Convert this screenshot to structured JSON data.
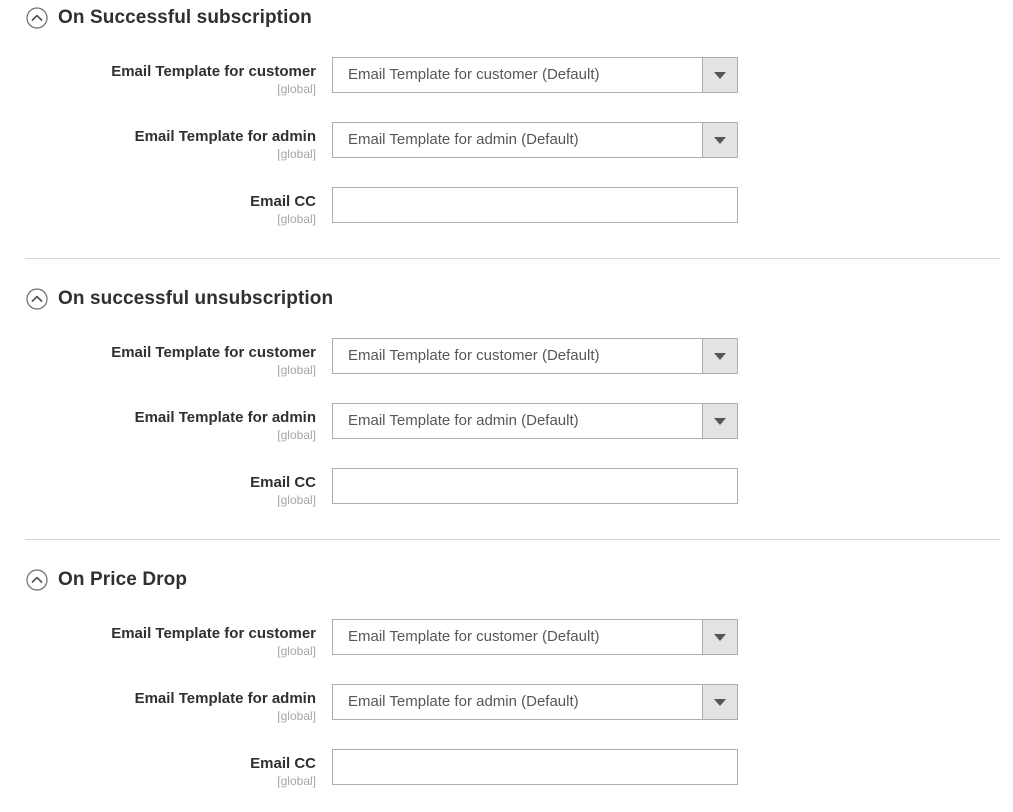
{
  "page": {
    "background_color": "#ffffff",
    "divider_color": "#d6d6d6",
    "label_color": "#303030",
    "scope_color": "#a6a6a6",
    "field_border_color": "#adadad",
    "select_button_color": "#e3e3e3"
  },
  "icons": {
    "collapse": "chevron-up-circle-icon",
    "dropdown": "caret-down-icon"
  },
  "scope_note": "[global]",
  "sections": [
    {
      "id": "on-successful-subscription",
      "title": "On Successful subscription",
      "fields": [
        {
          "id": "email-template-customer",
          "label": "Email Template for customer",
          "scope": "[global]",
          "type": "select",
          "value": "Email Template for customer (Default)"
        },
        {
          "id": "email-template-admin",
          "label": "Email Template for admin",
          "scope": "[global]",
          "type": "select",
          "value": "Email Template for admin (Default)"
        },
        {
          "id": "email-cc",
          "label": "Email CC",
          "scope": "[global]",
          "type": "text",
          "value": "",
          "placeholder": ""
        }
      ]
    },
    {
      "id": "on-successful-unsubscription",
      "title": "On successful unsubscription",
      "fields": [
        {
          "id": "email-template-customer",
          "label": "Email Template for customer",
          "scope": "[global]",
          "type": "select",
          "value": "Email Template for customer (Default)"
        },
        {
          "id": "email-template-admin",
          "label": "Email Template for admin",
          "scope": "[global]",
          "type": "select",
          "value": "Email Template for admin (Default)"
        },
        {
          "id": "email-cc",
          "label": "Email CC",
          "scope": "[global]",
          "type": "text",
          "value": "",
          "placeholder": ""
        }
      ]
    },
    {
      "id": "on-price-drop",
      "title": "On Price Drop",
      "fields": [
        {
          "id": "email-template-customer",
          "label": "Email Template for customer",
          "scope": "[global]",
          "type": "select",
          "value": "Email Template for customer (Default)"
        },
        {
          "id": "email-template-admin",
          "label": "Email Template for admin",
          "scope": "[global]",
          "type": "select",
          "value": "Email Template for admin (Default)"
        },
        {
          "id": "email-cc",
          "label": "Email CC",
          "scope": "[global]",
          "type": "text",
          "value": "",
          "placeholder": ""
        }
      ]
    }
  ]
}
